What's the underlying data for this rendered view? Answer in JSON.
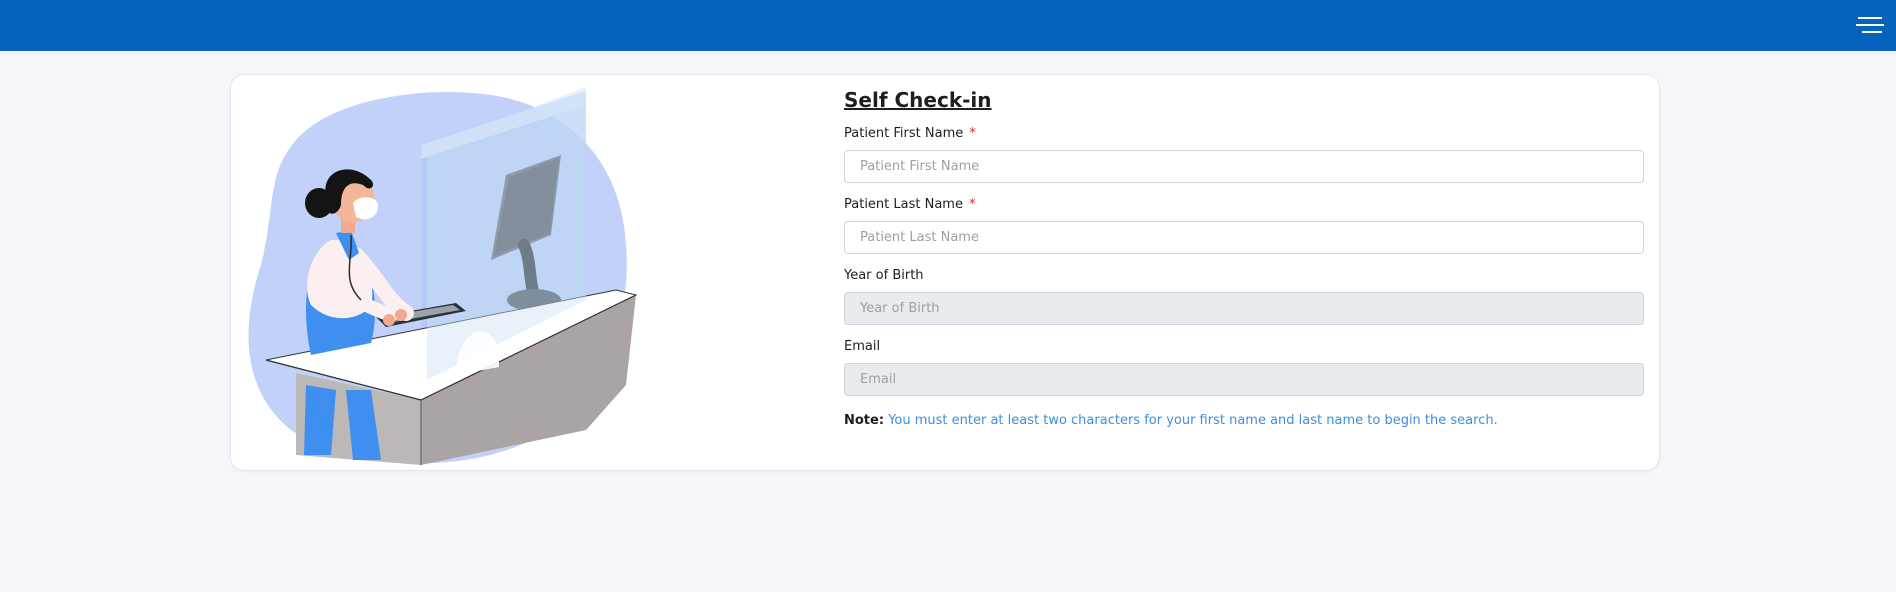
{
  "header": {
    "menu_icon": "hamburger-menu-icon",
    "background_color": "#0563bb"
  },
  "illustration": {
    "icon": "self-check-in-kiosk-illustration"
  },
  "form": {
    "title": "Self Check-in",
    "first_name": {
      "label": "Patient First Name",
      "required_mark": "*",
      "placeholder": "Patient First Name",
      "value": ""
    },
    "last_name": {
      "label": "Patient Last Name",
      "required_mark": "*",
      "placeholder": "Patient Last Name",
      "value": ""
    },
    "year_of_birth": {
      "label": "Year of Birth",
      "placeholder": "Year of Birth",
      "value": "",
      "disabled": true
    },
    "email": {
      "label": "Email",
      "placeholder": "Email",
      "value": "",
      "disabled": true
    },
    "note_label": "Note:",
    "note_text": "You must enter at least two characters for your first name and last name to begin the search."
  },
  "colors": {
    "accent": "#0563bb",
    "note": "#3b8ee0",
    "required": "#e0263a"
  }
}
